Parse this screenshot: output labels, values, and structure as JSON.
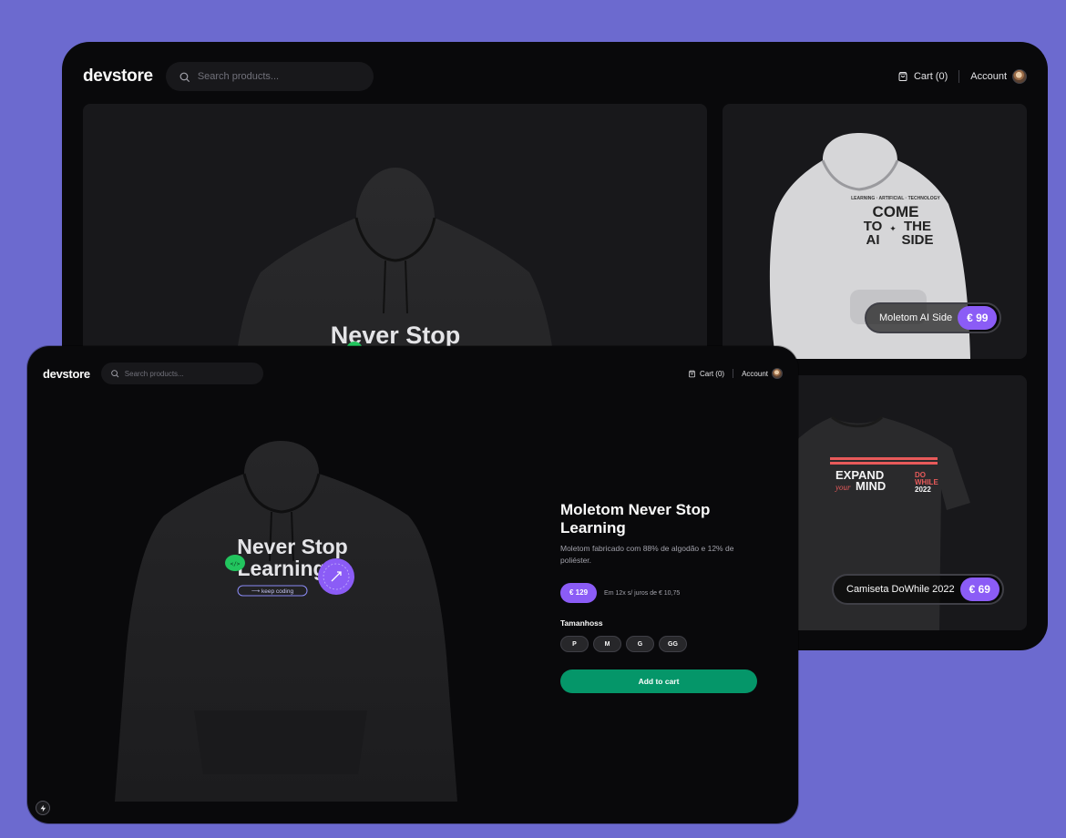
{
  "store": {
    "logo": "devstore",
    "search_placeholder": "Search products...",
    "cart_label": "Cart (0)",
    "account_label": "Account"
  },
  "home": {
    "featured_print": {
      "line1": "Never Stop"
    },
    "products": [
      {
        "name": "Moletom AI Side",
        "price": "€ 99",
        "print_lines": [
          "COME",
          "TO",
          "THE",
          "AI",
          "SIDE"
        ]
      },
      {
        "name": "Camiseta DoWhile 2022",
        "price": "€ 69",
        "print_lines": [
          "EXPAND",
          "your",
          "MIND",
          "DO",
          "WHILE",
          "2022"
        ]
      }
    ]
  },
  "product": {
    "title": "Moletom Never Stop Learning",
    "description": "Moletom fabricado com 88% de algodão e 12% de poliéster.",
    "price": "€ 129",
    "installments": "Em 12x s/ juros de € 10,75",
    "sizes_title": "Tamanhoss",
    "sizes": [
      "P",
      "M",
      "G",
      "GG"
    ],
    "add_to_cart": "Add to cart",
    "print": {
      "line1": "Never Stop",
      "line2": "Learning",
      "tag": "⟶ keep coding",
      "sticker": "</>"
    }
  },
  "colors": {
    "background": "#6c6acf",
    "window": "#09090b",
    "tile": "#18181b",
    "accent_violet": "#8b5cf6",
    "cta_green": "#059669"
  },
  "icons": [
    "search-icon",
    "shopping-bag-icon",
    "avatar",
    "bolt-icon"
  ]
}
